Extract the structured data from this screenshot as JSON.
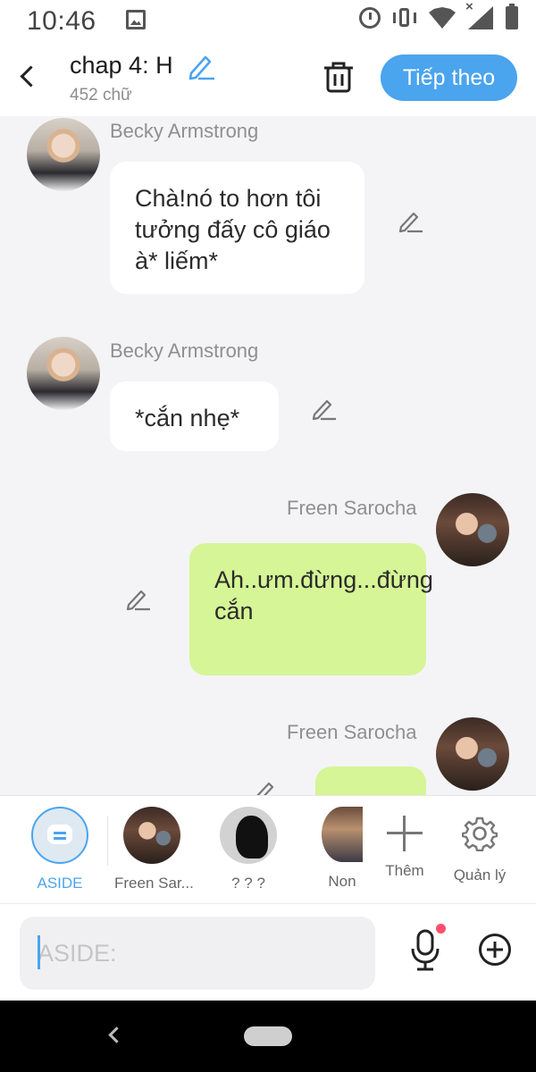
{
  "status_bar": {
    "time": "10:46"
  },
  "header": {
    "title": "chap 4: H",
    "subtitle": "452 chữ",
    "next_label": "Tiếp theo"
  },
  "messages": [
    {
      "side": "left",
      "sender": "Becky Armstrong",
      "text": "Chà!nó to hơn tôi tưởng đấy cô giáo à* liếm*"
    },
    {
      "side": "left",
      "sender": "Becky Armstrong",
      "text": "*cắn nhẹ*"
    },
    {
      "side": "right",
      "sender": "Freen Sarocha",
      "text": "Ah..ưm.đừng...đừng cắn"
    },
    {
      "side": "right",
      "sender": "Freen Sarocha",
      "text": ""
    }
  ],
  "characters": [
    {
      "label": "ASIDE",
      "selected": true
    },
    {
      "label": "Freen Sar..."
    },
    {
      "label": "? ? ?"
    },
    {
      "label": "Non"
    },
    {
      "label": "Thêm"
    },
    {
      "label": "Quản lý"
    }
  ],
  "input": {
    "placeholder": "ASIDE:"
  },
  "colors": {
    "accent": "#4aa4ee",
    "right_bubble": "#d6f596",
    "left_bubble": "#ffffff",
    "notification_dot": "#ff4f6a"
  },
  "icons": {
    "back": "chevron-left-icon",
    "edit": "pencil-icon",
    "delete": "trash-icon",
    "add_character": "plus-icon",
    "manage": "gear-icon",
    "mic": "microphone-icon",
    "add_content": "plus-circle-icon"
  }
}
